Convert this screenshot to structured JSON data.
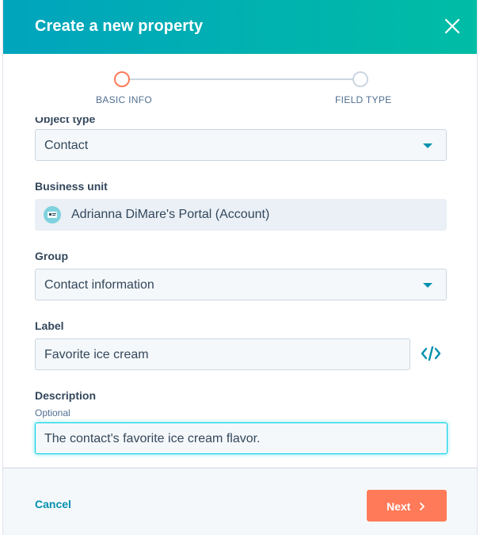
{
  "header": {
    "title": "Create a new property",
    "close_icon": "close-icon",
    "gradient": [
      "#00a4bd",
      "#00bda5"
    ]
  },
  "stepper": {
    "steps": [
      {
        "label": "BASIC INFO",
        "state": "active"
      },
      {
        "label": "FIELD TYPE",
        "state": "inactive"
      }
    ],
    "active_color": "#ff7a59",
    "inactive_color": "#cbd6e2"
  },
  "form": {
    "object_type": {
      "label": "Object type",
      "value": "Contact"
    },
    "business_unit": {
      "label": "Business unit",
      "value": "Adrianna DiMare's Portal (Account)",
      "icon": "portal-avatar-icon"
    },
    "group": {
      "label": "Group",
      "value": "Contact information"
    },
    "label_field": {
      "label": "Label",
      "value": "Favorite ice cream",
      "code_icon": "code-icon"
    },
    "description": {
      "label": "Description",
      "hint": "Optional",
      "value": "The contact's favorite ice cream flavor."
    }
  },
  "footer": {
    "cancel_label": "Cancel",
    "next_label": "Next",
    "next_icon": "chevron-right-icon",
    "accent": "#ff7a59",
    "link_color": "#0091ae"
  }
}
